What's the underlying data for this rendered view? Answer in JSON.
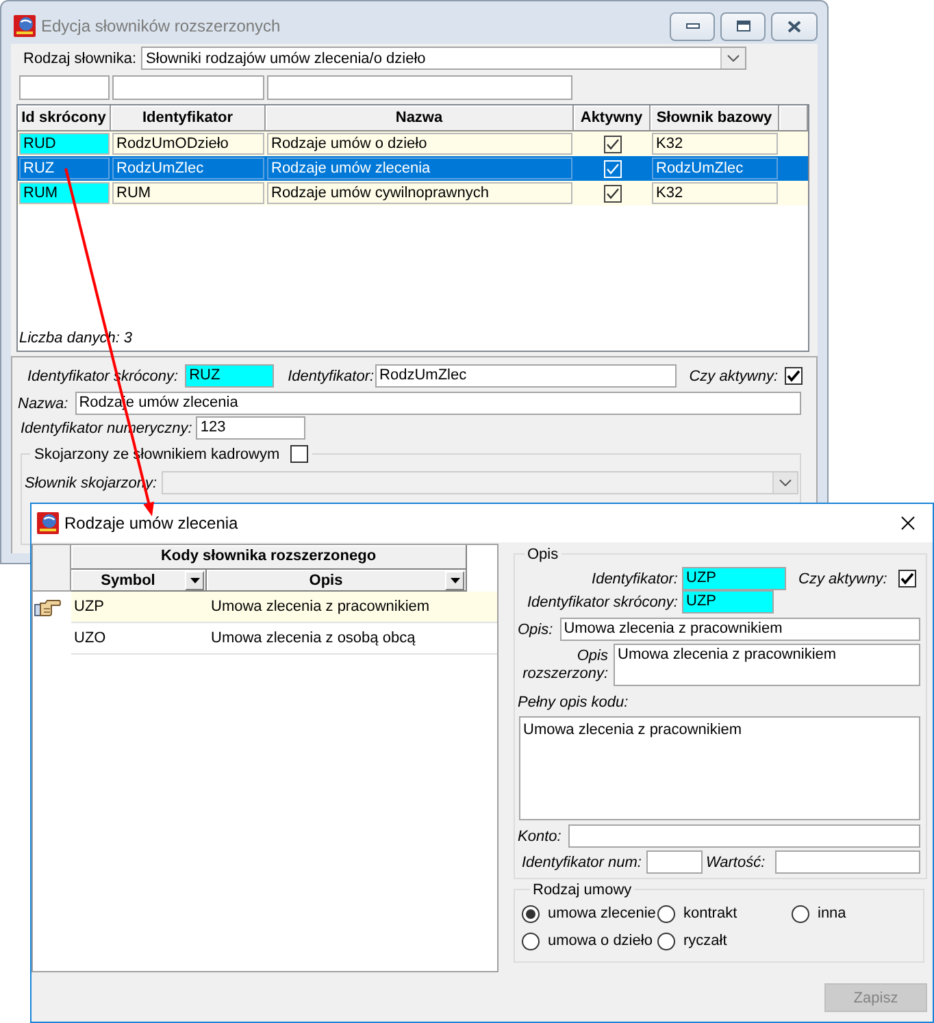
{
  "main_window": {
    "title": "Edycja słowników rozszerzonych",
    "active": false,
    "dictionary_type": {
      "label": "Rodzaj słownika:",
      "value": "Słowniki rodzajów umów zlecenia/o dzieło"
    },
    "table": {
      "columns": [
        {
          "label": "Id skrócony",
          "filter": true
        },
        {
          "label": "Identyfikator",
          "filter": true
        },
        {
          "label": "Nazwa",
          "filter": true
        },
        {
          "label": "Aktywny",
          "filter": false
        },
        {
          "label": "Słownik bazowy",
          "filter": false
        }
      ],
      "rows": [
        {
          "selected": false,
          "cells": [
            {
              "kind": "key",
              "text": "RUD"
            },
            {
              "kind": "text",
              "text": "RodzUmODzieło"
            },
            {
              "kind": "text",
              "text": "Rodzaje umów o dzieło"
            },
            {
              "kind": "check",
              "checked": true
            },
            {
              "kind": "text",
              "text": "K32"
            }
          ]
        },
        {
          "selected": true,
          "cells": [
            {
              "kind": "key",
              "text": "RUZ"
            },
            {
              "kind": "text",
              "text": "RodzUmZlec"
            },
            {
              "kind": "text",
              "text": "Rodzaje umów zlecenia"
            },
            {
              "kind": "check",
              "checked": true
            },
            {
              "kind": "text",
              "text": "RodzUmZlec"
            }
          ]
        },
        {
          "selected": false,
          "cells": [
            {
              "kind": "key",
              "text": "RUM"
            },
            {
              "kind": "text",
              "text": "RUM"
            },
            {
              "kind": "text",
              "text": "Rodzaje umów cywilnoprawnych"
            },
            {
              "kind": "check",
              "checked": true
            },
            {
              "kind": "text",
              "text": "K32"
            }
          ]
        }
      ],
      "count": "Liczba danych: 3"
    },
    "details": {
      "short_id": {
        "label": "Identyfikator skrócony:",
        "value": "RUZ"
      },
      "identifier": {
        "label": "Identyfikator:",
        "value": "RodzUmZlec"
      },
      "active": {
        "label": "Czy aktywny:",
        "checked": true
      },
      "name": {
        "label": "Nazwa:",
        "value": "Rodzaje umów zlecenia"
      },
      "numeric_id": {
        "label": "Identyfikator numeryczny:",
        "value": "123"
      },
      "hr_link": {
        "label": "Skojarzony ze słownikiem kadrowym",
        "checked": false
      },
      "linked_dictionary": {
        "label": "Słownik skojarzony:",
        "disabled": true
      }
    }
  },
  "code_window": {
    "title": "Rodzaje umów zlecenia",
    "active": true,
    "grid": {
      "group_header": "Kody słownika rozszerzonego",
      "columns": [
        {
          "label": "Symbol"
        },
        {
          "label": "Opis"
        }
      ],
      "rows": [
        {
          "symbol": "UZP",
          "description": "Umowa zlecenia z pracownikiem",
          "selected": true
        },
        {
          "symbol": "UZO",
          "description": "Umowa zlecenia z osobą obcą",
          "selected": false
        }
      ]
    },
    "description_group": {
      "title": "Opis",
      "identifier": {
        "label": "Identyfikator:",
        "value": "UZP"
      },
      "active": {
        "label": "Czy aktywny:",
        "checked": true
      },
      "short_id": {
        "label": "Identyfikator skrócony:",
        "value": "UZP"
      },
      "description": {
        "label": "Opis:",
        "value": "Umowa zlecenia z pracownikiem"
      },
      "extended_description": {
        "label": "Opis rozszerzony:",
        "value": "Umowa zlecenia z pracownikiem"
      },
      "full_description": {
        "label": "Pełny opis kodu:",
        "value": "Umowa zlecenia z pracownikiem"
      },
      "account": {
        "label": "Konto:"
      },
      "numeric_id": {
        "label": "Identyfikator num:"
      },
      "amount": {
        "label": "Wartość:"
      }
    },
    "contract_type": {
      "title": "Rodzaj umowy",
      "options": [
        {
          "label": "umowa zlecenie",
          "selected": true
        },
        {
          "label": "kontrakt",
          "selected": false
        },
        {
          "label": "inna",
          "selected": false
        },
        {
          "label": "umowa o dzieło",
          "selected": false
        },
        {
          "label": "ryczałt",
          "selected": false
        }
      ]
    },
    "save_button": {
      "label": "Zapisz",
      "disabled": true
    }
  }
}
